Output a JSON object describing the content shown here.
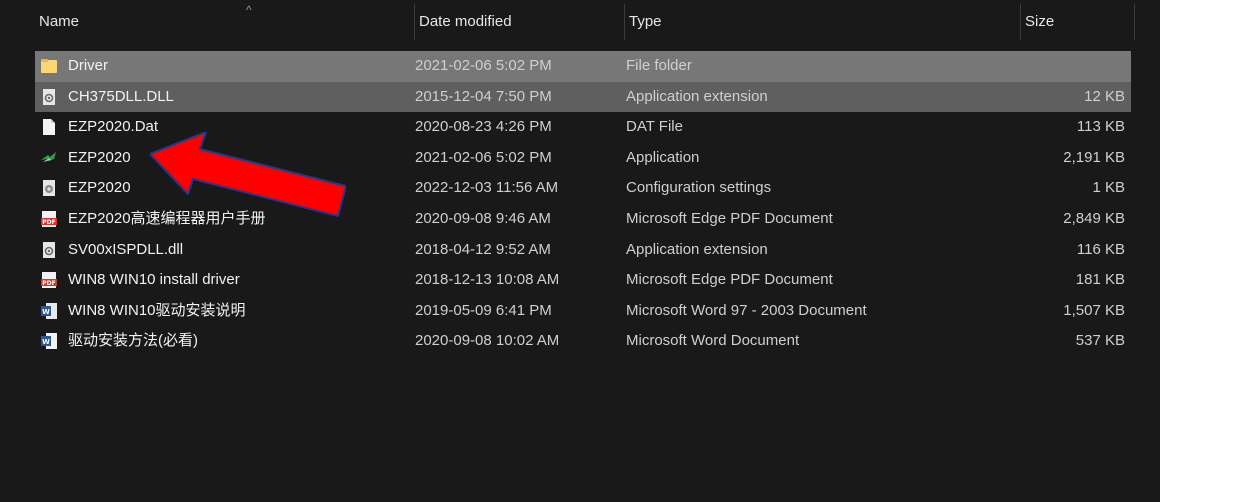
{
  "columns": {
    "name": "Name",
    "date": "Date modified",
    "type": "Type",
    "size": "Size"
  },
  "files": [
    {
      "name": "Driver",
      "date": "2021-02-06 5:02 PM",
      "type": "File folder",
      "size": "",
      "icon": "folder-icon"
    },
    {
      "name": "CH375DLL.DLL",
      "date": "2015-12-04 7:50 PM",
      "type": "Application extension",
      "size": "12 KB",
      "icon": "dll-icon"
    },
    {
      "name": "EZP2020.Dat",
      "date": "2020-08-23 4:26 PM",
      "type": "DAT File",
      "size": "113 KB",
      "icon": "file-icon"
    },
    {
      "name": "EZP2020",
      "date": "2021-02-06 5:02 PM",
      "type": "Application",
      "size": "2,191 KB",
      "icon": "application-icon"
    },
    {
      "name": "EZP2020",
      "date": "2022-12-03 11:56 AM",
      "type": "Configuration settings",
      "size": "1 KB",
      "icon": "config-icon"
    },
    {
      "name": "EZP2020高速编程器用户手册",
      "date": "2020-09-08 9:46 AM",
      "type": "Microsoft Edge PDF Document",
      "size": "2,849 KB",
      "icon": "pdf-icon"
    },
    {
      "name": "SV00xISPDLL.dll",
      "date": "2018-04-12 9:52 AM",
      "type": "Application extension",
      "size": "116 KB",
      "icon": "dll-icon"
    },
    {
      "name": "WIN8 WIN10 install driver",
      "date": "2018-12-13 10:08 AM",
      "type": "Microsoft Edge PDF Document",
      "size": "181 KB",
      "icon": "pdf-icon"
    },
    {
      "name": "WIN8 WIN10驱动安装说明",
      "date": "2019-05-09 6:41 PM",
      "type": "Microsoft Word 97 - 2003 Document",
      "size": "1,507 KB",
      "icon": "word-doc-icon"
    },
    {
      "name": "驱动安装方法(必看)",
      "date": "2020-09-08 10:02 AM",
      "type": "Microsoft Word Document",
      "size": "537 KB",
      "icon": "word-docx-icon"
    }
  ],
  "colors": {
    "background": "#191919",
    "selected": "#777777",
    "arrow_fill": "#ff0000",
    "arrow_outline": "#1f3a8a"
  }
}
